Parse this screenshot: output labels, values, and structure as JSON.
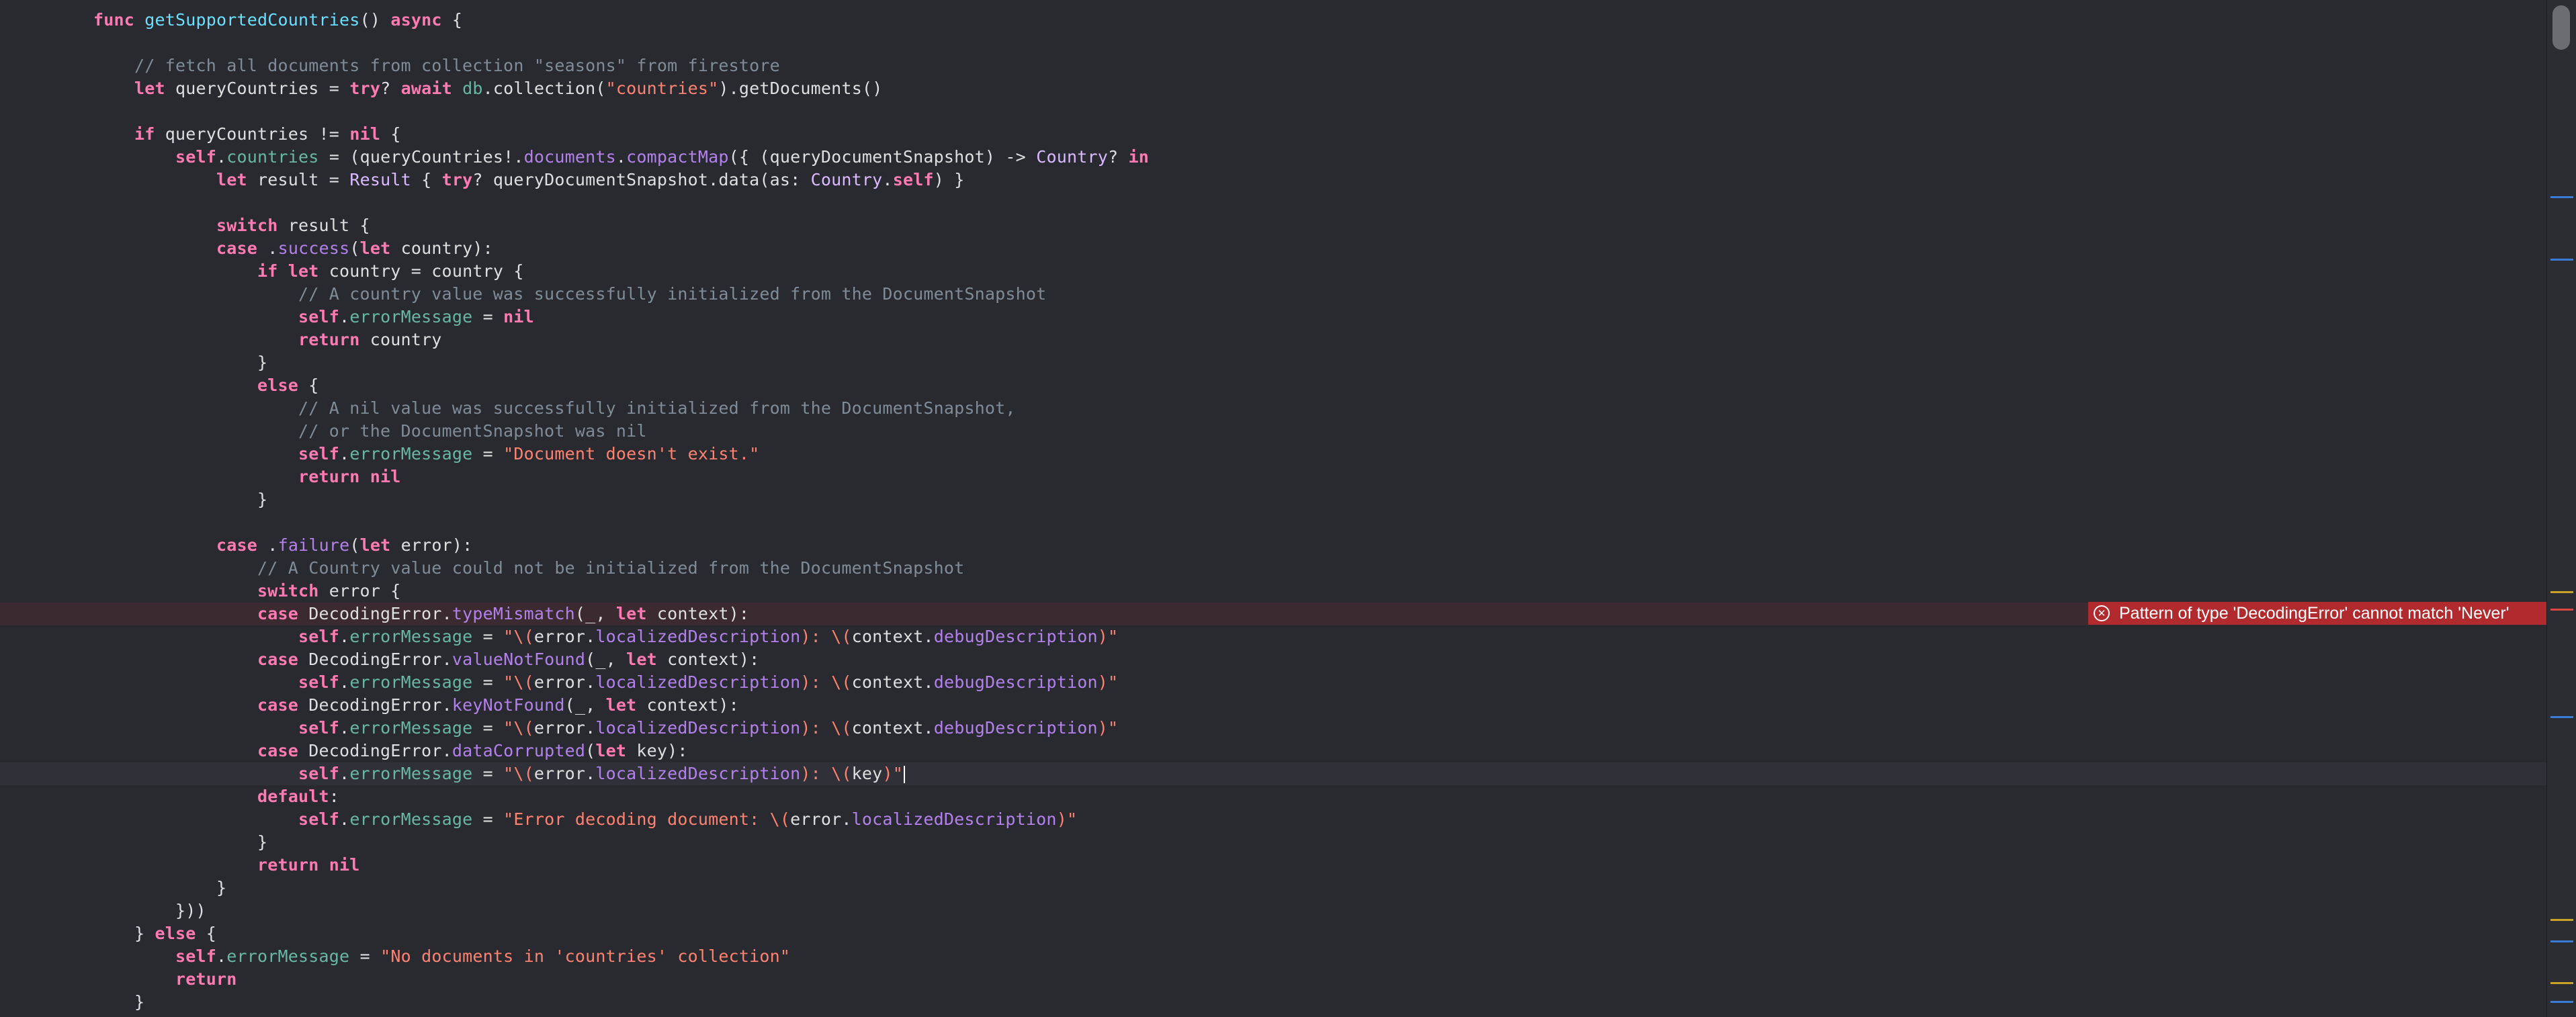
{
  "editor": {
    "lines": [
      {
        "indent": "    ",
        "tokens": [
          [
            "kw",
            "func "
          ],
          [
            "fn",
            "getSupportedCountries"
          ],
          [
            "plain",
            "() "
          ],
          [
            "kw",
            "async"
          ],
          [
            "plain",
            " {"
          ]
        ]
      },
      {
        "indent": "",
        "tokens": []
      },
      {
        "indent": "        ",
        "tokens": [
          [
            "com",
            "// fetch all documents from collection \"seasons\" from firestore"
          ]
        ]
      },
      {
        "indent": "        ",
        "tokens": [
          [
            "kw",
            "let"
          ],
          [
            "plain",
            " queryCountries = "
          ],
          [
            "kw",
            "try"
          ],
          [
            "plain",
            "? "
          ],
          [
            "kw",
            "await"
          ],
          [
            "plain",
            " "
          ],
          [
            "prop",
            "db"
          ],
          [
            "plain",
            ".collection("
          ],
          [
            "str",
            "\"countries\""
          ],
          [
            "plain",
            ").getDocuments()"
          ]
        ]
      },
      {
        "indent": "",
        "tokens": []
      },
      {
        "indent": "        ",
        "tokens": [
          [
            "kw",
            "if"
          ],
          [
            "plain",
            " queryCountries != "
          ],
          [
            "kw",
            "nil"
          ],
          [
            "plain",
            " {"
          ]
        ]
      },
      {
        "indent": "            ",
        "tokens": [
          [
            "kw",
            "self"
          ],
          [
            "plain",
            "."
          ],
          [
            "prop",
            "countries"
          ],
          [
            "plain",
            " = (queryCountries!."
          ],
          [
            "call",
            "documents"
          ],
          [
            "plain",
            "."
          ],
          [
            "call",
            "compactMap"
          ],
          [
            "plain",
            "({ (queryDocumentSnapshot) -> "
          ],
          [
            "type",
            "Country"
          ],
          [
            "plain",
            "? "
          ],
          [
            "kw",
            "in"
          ]
        ]
      },
      {
        "indent": "                ",
        "tokens": [
          [
            "kw",
            "let"
          ],
          [
            "plain",
            " result = "
          ],
          [
            "type",
            "Result"
          ],
          [
            "plain",
            " { "
          ],
          [
            "kw",
            "try"
          ],
          [
            "plain",
            "? queryDocumentSnapshot.data(as: "
          ],
          [
            "type",
            "Country"
          ],
          [
            "plain",
            "."
          ],
          [
            "kw",
            "self"
          ],
          [
            "plain",
            ") }"
          ]
        ]
      },
      {
        "indent": "",
        "tokens": []
      },
      {
        "indent": "                ",
        "tokens": [
          [
            "kw",
            "switch"
          ],
          [
            "plain",
            " result {"
          ]
        ]
      },
      {
        "indent": "                ",
        "tokens": [
          [
            "kw",
            "case"
          ],
          [
            "plain",
            " ."
          ],
          [
            "call",
            "success"
          ],
          [
            "plain",
            "("
          ],
          [
            "kw",
            "let"
          ],
          [
            "plain",
            " country):"
          ]
        ]
      },
      {
        "indent": "                    ",
        "tokens": [
          [
            "kw",
            "if let"
          ],
          [
            "plain",
            " country = country {"
          ]
        ]
      },
      {
        "indent": "                        ",
        "tokens": [
          [
            "com",
            "// A country value was successfully initialized from the DocumentSnapshot"
          ]
        ]
      },
      {
        "indent": "                        ",
        "tokens": [
          [
            "kw",
            "self"
          ],
          [
            "plain",
            "."
          ],
          [
            "prop",
            "errorMessage"
          ],
          [
            "plain",
            " = "
          ],
          [
            "kw",
            "nil"
          ]
        ]
      },
      {
        "indent": "                        ",
        "tokens": [
          [
            "kw",
            "return"
          ],
          [
            "plain",
            " country"
          ]
        ]
      },
      {
        "indent": "                    ",
        "tokens": [
          [
            "plain",
            "}"
          ]
        ]
      },
      {
        "indent": "                    ",
        "tokens": [
          [
            "kw",
            "else"
          ],
          [
            "plain",
            " {"
          ]
        ]
      },
      {
        "indent": "                        ",
        "tokens": [
          [
            "com",
            "// A nil value was successfully initialized from the DocumentSnapshot,"
          ]
        ]
      },
      {
        "indent": "                        ",
        "tokens": [
          [
            "com",
            "// or the DocumentSnapshot was nil"
          ]
        ]
      },
      {
        "indent": "                        ",
        "tokens": [
          [
            "kw",
            "self"
          ],
          [
            "plain",
            "."
          ],
          [
            "prop",
            "errorMessage"
          ],
          [
            "plain",
            " = "
          ],
          [
            "str",
            "\"Document doesn't exist.\""
          ]
        ]
      },
      {
        "indent": "                        ",
        "tokens": [
          [
            "kw",
            "return nil"
          ]
        ]
      },
      {
        "indent": "                    ",
        "tokens": [
          [
            "plain",
            "}"
          ]
        ]
      },
      {
        "indent": "",
        "tokens": []
      },
      {
        "indent": "                ",
        "tokens": [
          [
            "kw",
            "case"
          ],
          [
            "plain",
            " ."
          ],
          [
            "call",
            "failure"
          ],
          [
            "plain",
            "("
          ],
          [
            "kw",
            "let"
          ],
          [
            "plain",
            " error):"
          ]
        ]
      },
      {
        "indent": "                    ",
        "tokens": [
          [
            "com",
            "// A Country value could not be initialized from the DocumentSnapshot"
          ]
        ]
      },
      {
        "indent": "                    ",
        "tokens": [
          [
            "kw",
            "switch"
          ],
          [
            "plain",
            " error {"
          ]
        ]
      },
      {
        "indent": "                    ",
        "highlight": "error",
        "tokens": [
          [
            "kw",
            "case"
          ],
          [
            "plain",
            " DecodingError."
          ],
          [
            "call",
            "typeMismatch"
          ],
          [
            "plain",
            "(_, "
          ],
          [
            "kw",
            "let"
          ],
          [
            "plain",
            " context):"
          ]
        ]
      },
      {
        "indent": "                        ",
        "tokens": [
          [
            "kw",
            "self"
          ],
          [
            "plain",
            "."
          ],
          [
            "prop",
            "errorMessage"
          ],
          [
            "plain",
            " = "
          ],
          [
            "str",
            "\"\\("
          ],
          [
            "plain",
            "error."
          ],
          [
            "call",
            "localizedDescription"
          ],
          [
            "str",
            "): \\("
          ],
          [
            "plain",
            "context."
          ],
          [
            "call",
            "debugDescription"
          ],
          [
            "str",
            ")\""
          ]
        ]
      },
      {
        "indent": "                    ",
        "tokens": [
          [
            "kw",
            "case"
          ],
          [
            "plain",
            " DecodingError."
          ],
          [
            "call",
            "valueNotFound"
          ],
          [
            "plain",
            "(_, "
          ],
          [
            "kw",
            "let"
          ],
          [
            "plain",
            " context):"
          ]
        ]
      },
      {
        "indent": "                        ",
        "tokens": [
          [
            "kw",
            "self"
          ],
          [
            "plain",
            "."
          ],
          [
            "prop",
            "errorMessage"
          ],
          [
            "plain",
            " = "
          ],
          [
            "str",
            "\"\\("
          ],
          [
            "plain",
            "error."
          ],
          [
            "call",
            "localizedDescription"
          ],
          [
            "str",
            "): \\("
          ],
          [
            "plain",
            "context."
          ],
          [
            "call",
            "debugDescription"
          ],
          [
            "str",
            ")\""
          ]
        ]
      },
      {
        "indent": "                    ",
        "tokens": [
          [
            "kw",
            "case"
          ],
          [
            "plain",
            " DecodingError."
          ],
          [
            "call",
            "keyNotFound"
          ],
          [
            "plain",
            "(_, "
          ],
          [
            "kw",
            "let"
          ],
          [
            "plain",
            " context):"
          ]
        ]
      },
      {
        "indent": "                        ",
        "tokens": [
          [
            "kw",
            "self"
          ],
          [
            "plain",
            "."
          ],
          [
            "prop",
            "errorMessage"
          ],
          [
            "plain",
            " = "
          ],
          [
            "str",
            "\"\\("
          ],
          [
            "plain",
            "error."
          ],
          [
            "call",
            "localizedDescription"
          ],
          [
            "str",
            "): \\("
          ],
          [
            "plain",
            "context."
          ],
          [
            "call",
            "debugDescription"
          ],
          [
            "str",
            ")\""
          ]
        ]
      },
      {
        "indent": "                    ",
        "tokens": [
          [
            "kw",
            "case"
          ],
          [
            "plain",
            " DecodingError."
          ],
          [
            "call",
            "dataCorrupted"
          ],
          [
            "plain",
            "("
          ],
          [
            "kw",
            "let"
          ],
          [
            "plain",
            " key):"
          ]
        ]
      },
      {
        "indent": "                        ",
        "highlight": "current",
        "cursor": true,
        "tokens": [
          [
            "kw",
            "self"
          ],
          [
            "plain",
            "."
          ],
          [
            "prop",
            "errorMessage"
          ],
          [
            "plain",
            " = "
          ],
          [
            "str",
            "\"\\("
          ],
          [
            "plain",
            "error."
          ],
          [
            "call",
            "localizedDescription"
          ],
          [
            "str",
            "): \\("
          ],
          [
            "plain",
            "key"
          ],
          [
            "str",
            ")\""
          ]
        ]
      },
      {
        "indent": "                    ",
        "tokens": [
          [
            "kw",
            "default"
          ],
          [
            "plain",
            ":"
          ]
        ]
      },
      {
        "indent": "                        ",
        "tokens": [
          [
            "kw",
            "self"
          ],
          [
            "plain",
            "."
          ],
          [
            "prop",
            "errorMessage"
          ],
          [
            "plain",
            " = "
          ],
          [
            "str",
            "\"Error decoding document: \\("
          ],
          [
            "plain",
            "error."
          ],
          [
            "call",
            "localizedDescription"
          ],
          [
            "str",
            ")\""
          ]
        ]
      },
      {
        "indent": "                    ",
        "tokens": [
          [
            "plain",
            "}"
          ]
        ]
      },
      {
        "indent": "                    ",
        "tokens": [
          [
            "kw",
            "return nil"
          ]
        ]
      },
      {
        "indent": "                ",
        "tokens": [
          [
            "plain",
            "}"
          ]
        ]
      },
      {
        "indent": "            ",
        "tokens": [
          [
            "plain",
            "}))"
          ]
        ]
      },
      {
        "indent": "        ",
        "tokens": [
          [
            "plain",
            "} "
          ],
          [
            "kw",
            "else"
          ],
          [
            "plain",
            " {"
          ]
        ]
      },
      {
        "indent": "            ",
        "tokens": [
          [
            "kw",
            "self"
          ],
          [
            "plain",
            "."
          ],
          [
            "prop",
            "errorMessage"
          ],
          [
            "plain",
            " = "
          ],
          [
            "str",
            "\"No documents in 'countries' collection\""
          ]
        ]
      },
      {
        "indent": "            ",
        "tokens": [
          [
            "kw",
            "return"
          ]
        ]
      },
      {
        "indent": "        ",
        "tokens": [
          [
            "plain",
            "}"
          ]
        ]
      }
    ]
  },
  "error": {
    "icon": "error-circle-icon",
    "message": "Pattern of type 'DecodingError' cannot match 'Never'"
  },
  "colors": {
    "background": "#292a30",
    "keyword": "#ff7ab2",
    "function": "#6bdfff",
    "property": "#67b7a4",
    "method": "#b281eb",
    "type": "#dabaff",
    "string": "#ff8170",
    "comment": "#7f8c98",
    "error": "#b12b2e"
  },
  "scrollbar": {
    "markers": [
      "blue",
      "blue",
      "yellow",
      "red",
      "blue",
      "yellow",
      "blue",
      "yellow",
      "blue"
    ]
  }
}
